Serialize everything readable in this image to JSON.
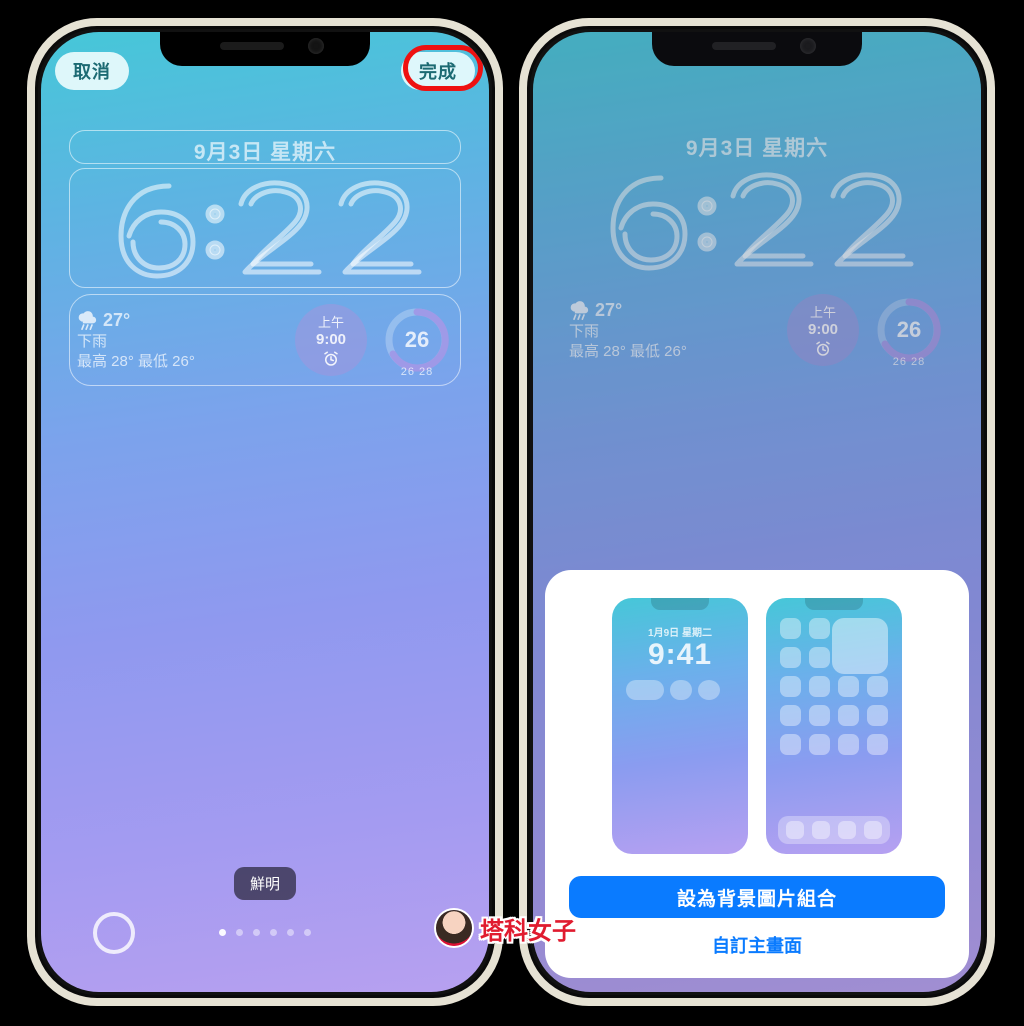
{
  "left": {
    "cancel_label": "取消",
    "done_label": "完成",
    "date_text": "9月3日 星期六",
    "clock_text": "6:22",
    "weather": {
      "icon": "rain",
      "temp": "27°",
      "desc": "下雨",
      "hi_lo": "最高 28° 最低 26°"
    },
    "alarm": {
      "ampm": "上午",
      "time": "9:00"
    },
    "ring_center": "26",
    "ring_below": "26 28",
    "style_chip": "鮮明",
    "page_count": 6,
    "page_active_index": 0
  },
  "right": {
    "date_text": "9月3日 星期六",
    "clock_text": "6:22",
    "weather": {
      "icon": "rain",
      "temp": "27°",
      "desc": "下雨",
      "hi_lo": "最高 28° 最低 26°"
    },
    "alarm": {
      "ampm": "上午",
      "time": "9:00"
    },
    "ring_center": "26",
    "ring_below": "26 28",
    "sheet": {
      "mini_lock_date": "1月9日 星期二",
      "mini_lock_time": "9:41",
      "primary_label": "設為背景圖片組合",
      "secondary_label": "自訂主畫面"
    }
  },
  "watermark_text": "塔科女子",
  "colors": {
    "accent_blue": "#0a7bff",
    "highlight_red": "#e11"
  }
}
